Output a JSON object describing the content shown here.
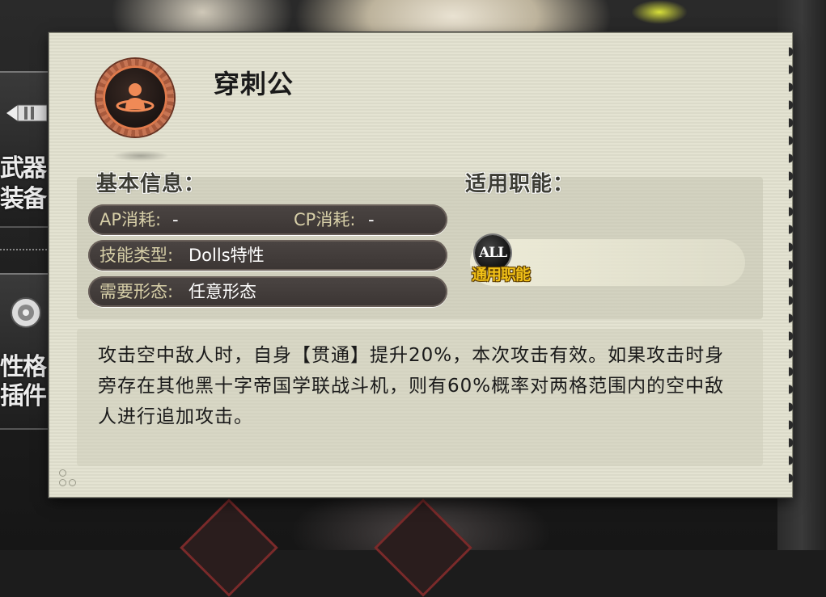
{
  "side_menu": {
    "items": [
      {
        "label_line1": "武器",
        "label_line2": "装备",
        "icon": "weapon-icon"
      },
      {
        "label_line1": "性格",
        "label_line2": "插件",
        "icon": "gear-icon"
      }
    ]
  },
  "skill": {
    "icon": "person-orbit-icon",
    "name": "穿刺公"
  },
  "basic_info": {
    "heading": "基本信息：",
    "ap_label": "AP消耗:",
    "ap_value": "-",
    "cp_label": "CP消耗:",
    "cp_value": "-",
    "type_label": "技能类型:",
    "type_value": "Dolls特性",
    "form_label": "需要形态:",
    "form_value": "任意形态"
  },
  "roles": {
    "heading": "适用职能：",
    "badge_coin": "ALL",
    "badge_text": "通用职能"
  },
  "description": "攻击空中敌人时，自身【贯通】提升20%，本次攻击有效。如果攻击时身旁存在其他黑十字帝国学联战斗机，则有60%概率对两格范围内的空中敌人进行追加攻击。",
  "colors": {
    "dialog_bg": "#e2e1cf",
    "info_bar": "#443e3c",
    "label_text": "#d7cfa8",
    "role_gold": "#f0c018",
    "skill_icon_ring": "#c77554"
  }
}
